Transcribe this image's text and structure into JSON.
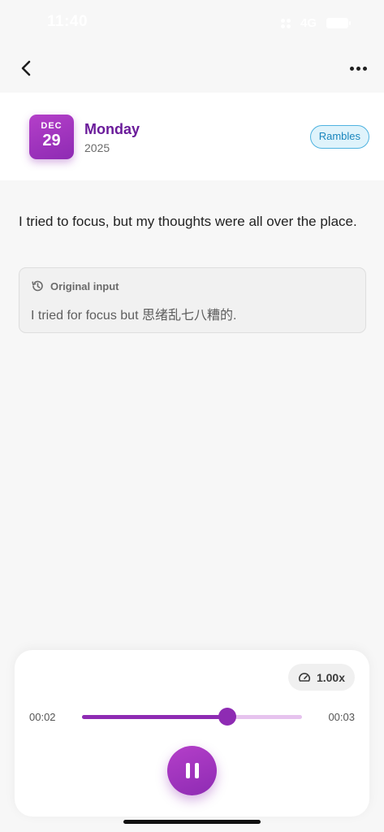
{
  "status_bar": {
    "time": "11:40",
    "network": "4G",
    "icons": [
      "signal-icon",
      "battery-icon"
    ]
  },
  "nav": {
    "back_icon": "chevron-left-icon",
    "more_icon": "more-horizontal-icon"
  },
  "entry": {
    "date": {
      "month": "DEC",
      "day": "29",
      "weekday": "Monday",
      "year": "2025"
    },
    "category": "Rambles",
    "text": "I tried to focus, but my thoughts were all over the place.",
    "original": {
      "title": "Original input",
      "icon": "history-icon",
      "text": "I tried for focus but 思绪乱七八糟的."
    }
  },
  "player": {
    "speed": "1.00x",
    "speed_icon": "gauge-icon",
    "current_time": "00:02",
    "total_time": "00:03",
    "progress": 0.66,
    "state_icon": "pause-icon"
  },
  "colors": {
    "accent": "#8e2bb3",
    "accent_light": "#e6c3ee",
    "weekday_text": "#6a1b9a",
    "tag_border": "#4fb3e0",
    "tag_bg": "#dff3fb",
    "tag_text": "#1a86bd"
  }
}
